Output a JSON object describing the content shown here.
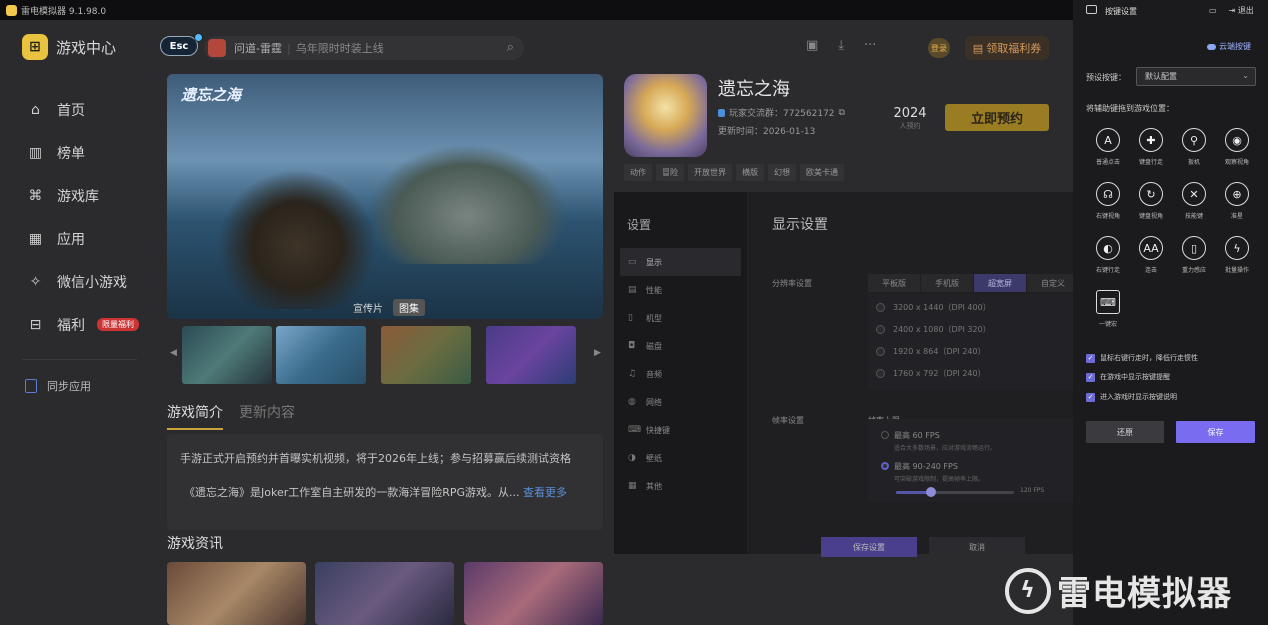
{
  "titlebar": {
    "title": "雷电模拟器 9.1.98.0"
  },
  "brand": {
    "name": "游戏中心"
  },
  "nav": {
    "items": [
      {
        "label": "首页",
        "icon": "home-icon"
      },
      {
        "label": "榜单",
        "icon": "chart-icon"
      },
      {
        "label": "游戏库",
        "icon": "gamepad-icon"
      },
      {
        "label": "应用",
        "icon": "apps-icon"
      },
      {
        "label": "微信小游戏",
        "icon": "wechat-icon"
      },
      {
        "label": "福利",
        "icon": "gift-icon",
        "badge": "限量福利"
      }
    ]
  },
  "sync": {
    "label": "同步应用"
  },
  "top": {
    "esc": "Esc",
    "search_hot": "问道-雷霆",
    "search_placeholder": "乌年限时时装上线",
    "login": "登录",
    "welfare": "领取福利券"
  },
  "hero": {
    "logo": "遗忘之海",
    "tabs": [
      "宣传片",
      "图集"
    ]
  },
  "intro": {
    "tab_active": "游戏简介",
    "tab_other": "更新内容",
    "p1": "手游正式开启预约并首曝实机视频，将于2026年上线；参与招募赢后续测试资格",
    "p2": "《遗忘之海》是Joker工作室自主研发的一款海洋冒险RPG游戏。从...",
    "more": "查看更多"
  },
  "news": {
    "title": "游戏资讯"
  },
  "game": {
    "title": "遗忘之海",
    "qq": "玩家交流群：772562172",
    "date": "更新时间：2026-01-13",
    "year": "2024",
    "year_label": "人预约",
    "reserve": "立即预约",
    "tags": [
      "动作",
      "冒险",
      "开放世界",
      "横版",
      "幻想",
      "欧美卡通"
    ]
  },
  "settings": {
    "title": "设置",
    "menu": [
      "显示",
      "性能",
      "机型",
      "磁盘",
      "音频",
      "网络",
      "快捷键",
      "壁纸",
      "其他"
    ],
    "display_title": "显示设置",
    "res_label": "分辨率设置",
    "res_tabs": [
      "平板版",
      "手机版",
      "超宽屏",
      "自定义"
    ],
    "res_opts": [
      "3200 x 1440（DPI 400）",
      "2400 x 1080（DPI 320）",
      "1920 x 864（DPI 240）",
      "1760 x 792（DPI 240）"
    ],
    "fps_label": "帧率设置",
    "fps_cap": "帧率上限",
    "fps1": "最高 60 FPS",
    "fps1_sub": "适合大多数场景，应对游戏流畅运行。",
    "fps2": "最高 90-240 FPS",
    "fps2_sub": "可突破游戏限制，提高帧率上限。",
    "fps_value": "120 FPS",
    "fps_fraction": 0.3,
    "save": "保存设置",
    "cancel": "取消"
  },
  "keys": {
    "title": "按键设置",
    "exit": "退出",
    "cloud": "云端按键",
    "preset_label": "预设按键：",
    "preset_value": "默认配置",
    "drag_label": "将辅助键拖到游戏位置：",
    "items": [
      {
        "label": "普通点击",
        "glyph": "A",
        "icon": "letter-a-icon"
      },
      {
        "label": "键盘行走",
        "glyph": "✚",
        "icon": "dpad-icon"
      },
      {
        "label": "扳机",
        "glyph": "⚲",
        "icon": "trigger-icon"
      },
      {
        "label": "观察视角",
        "glyph": "◉",
        "icon": "eye-icon"
      },
      {
        "label": "右键视角",
        "glyph": "☊",
        "icon": "right-view-icon"
      },
      {
        "label": "键盘视角",
        "glyph": "↻",
        "icon": "keyboard-view-icon"
      },
      {
        "label": "技能键",
        "glyph": "✕",
        "icon": "skill-icon"
      },
      {
        "label": "准星",
        "glyph": "⊕",
        "icon": "crosshair-icon"
      },
      {
        "label": "右键行走",
        "glyph": "◐",
        "icon": "mouse-icon"
      },
      {
        "label": "连击",
        "glyph": "AA",
        "icon": "combo-icon"
      },
      {
        "label": "重力感应",
        "glyph": "▯",
        "icon": "gravity-icon"
      },
      {
        "label": "批量操作",
        "glyph": "ϟ",
        "icon": "batch-icon"
      },
      {
        "label": "一键宏",
        "glyph": "⌨",
        "icon": "macro-icon"
      }
    ],
    "checks": [
      "鼠标右键行走时，降低行走惯性",
      "在游戏中显示按键提醒",
      "进入游戏时显示按键说明"
    ],
    "restore": "还原",
    "save": "保存"
  },
  "watermark": {
    "text": "雷电模拟器"
  }
}
